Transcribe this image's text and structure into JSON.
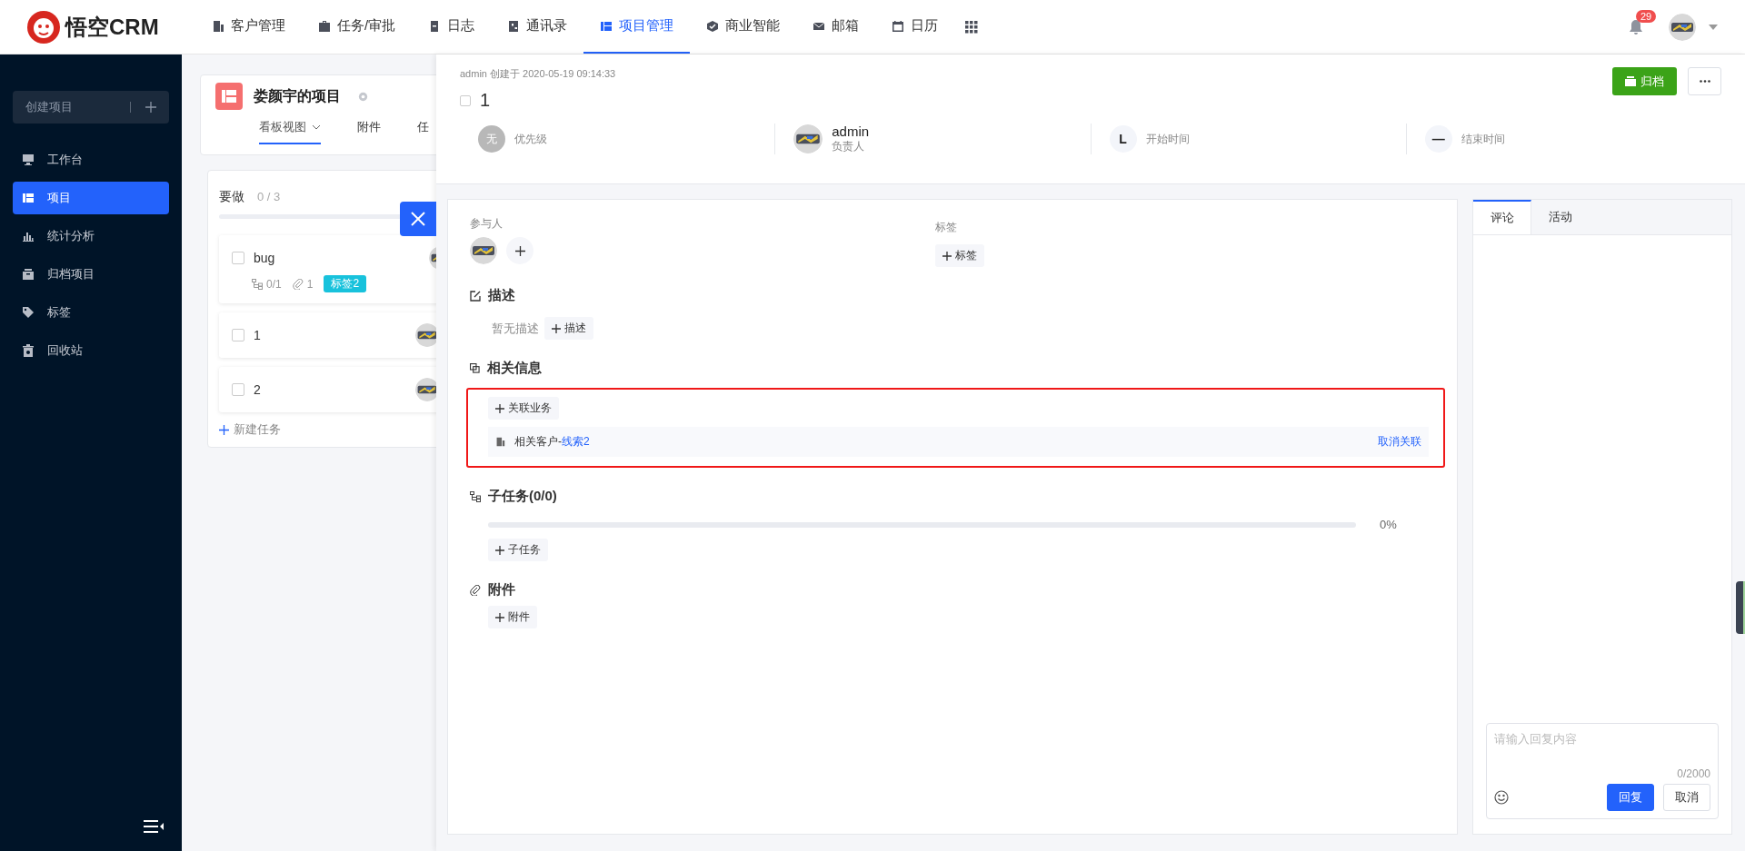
{
  "app": {
    "logo_text": "悟空CRM"
  },
  "nav": [
    {
      "label": "客户管理",
      "kind": "building",
      "selected": false
    },
    {
      "label": "任务/审批",
      "kind": "briefcase",
      "selected": false
    },
    {
      "label": "日志",
      "kind": "log",
      "selected": false
    },
    {
      "label": "通讯录",
      "kind": "phone",
      "selected": false
    },
    {
      "label": "项目管理",
      "kind": "board",
      "selected": true
    },
    {
      "label": "商业智能",
      "kind": "cube",
      "selected": false
    },
    {
      "label": "邮箱",
      "kind": "mail",
      "selected": false
    },
    {
      "label": "日历",
      "kind": "calendar",
      "selected": false
    }
  ],
  "notifications": {
    "count": "29"
  },
  "sidebar": {
    "create_button": "创建项目",
    "items": [
      {
        "label": "工作台",
        "kind": "monitor",
        "selected": false
      },
      {
        "label": "项目",
        "kind": "board",
        "selected": true
      },
      {
        "label": "统计分析",
        "kind": "chart",
        "selected": false
      },
      {
        "label": "归档项目",
        "kind": "box",
        "selected": false
      },
      {
        "label": "标签",
        "kind": "tag",
        "selected": false
      },
      {
        "label": "回收站",
        "kind": "trash",
        "selected": false
      }
    ]
  },
  "project": {
    "title": "娄颜宇的项目",
    "tabs": [
      {
        "label": "看板视图",
        "selected": true,
        "dropdown": true
      },
      {
        "label": "附件",
        "selected": false,
        "dropdown": false
      },
      {
        "label": "任",
        "selected": false,
        "dropdown": false
      }
    ]
  },
  "column": {
    "title": "要做",
    "count": "0 / 3",
    "tasks": [
      {
        "title": "bug",
        "checked": false,
        "subtasks": "0/1",
        "attachments": "1",
        "tag": {
          "label": "标签2",
          "color": "#18c2dc"
        }
      },
      {
        "title": "1",
        "checked": false
      },
      {
        "title": "2",
        "checked": false
      }
    ],
    "new_task": "新建任务"
  },
  "task_detail": {
    "created": "admin 创建于 2020-05-19 09:14:33",
    "checked": false,
    "title": "1",
    "archive_button": "归档",
    "fields": [
      {
        "kind": "priority",
        "badge": "无",
        "label": "优先级"
      },
      {
        "kind": "owner",
        "value": "admin",
        "label": "负责人"
      },
      {
        "kind": "start",
        "badge": "L",
        "label": "开始时间"
      },
      {
        "kind": "end",
        "badge": "—",
        "label": "结束时间"
      }
    ],
    "participants_label": "参与人",
    "tags_label": "标签",
    "add_tag": "标签",
    "description": {
      "title": "描述",
      "empty": "暂无描述",
      "add": "描述"
    },
    "related": {
      "title": "相关信息",
      "highlighted": true,
      "add": "关联业务",
      "items": [
        {
          "label": "相关客户-",
          "link": "线索2",
          "action": "取消关联"
        }
      ]
    },
    "subtasks": {
      "title": "子任务(0/0)",
      "level": 0,
      "percent": "0%",
      "add": "子任务"
    },
    "attachments": {
      "title": "附件",
      "add": "附件"
    }
  },
  "comments": {
    "tabs": [
      {
        "label": "评论",
        "selected": true
      },
      {
        "label": "活动",
        "selected": false
      }
    ],
    "placeholder": "请输入回复内容",
    "counter": "0/2000",
    "reply_button": "回复",
    "cancel_button": "取消"
  }
}
